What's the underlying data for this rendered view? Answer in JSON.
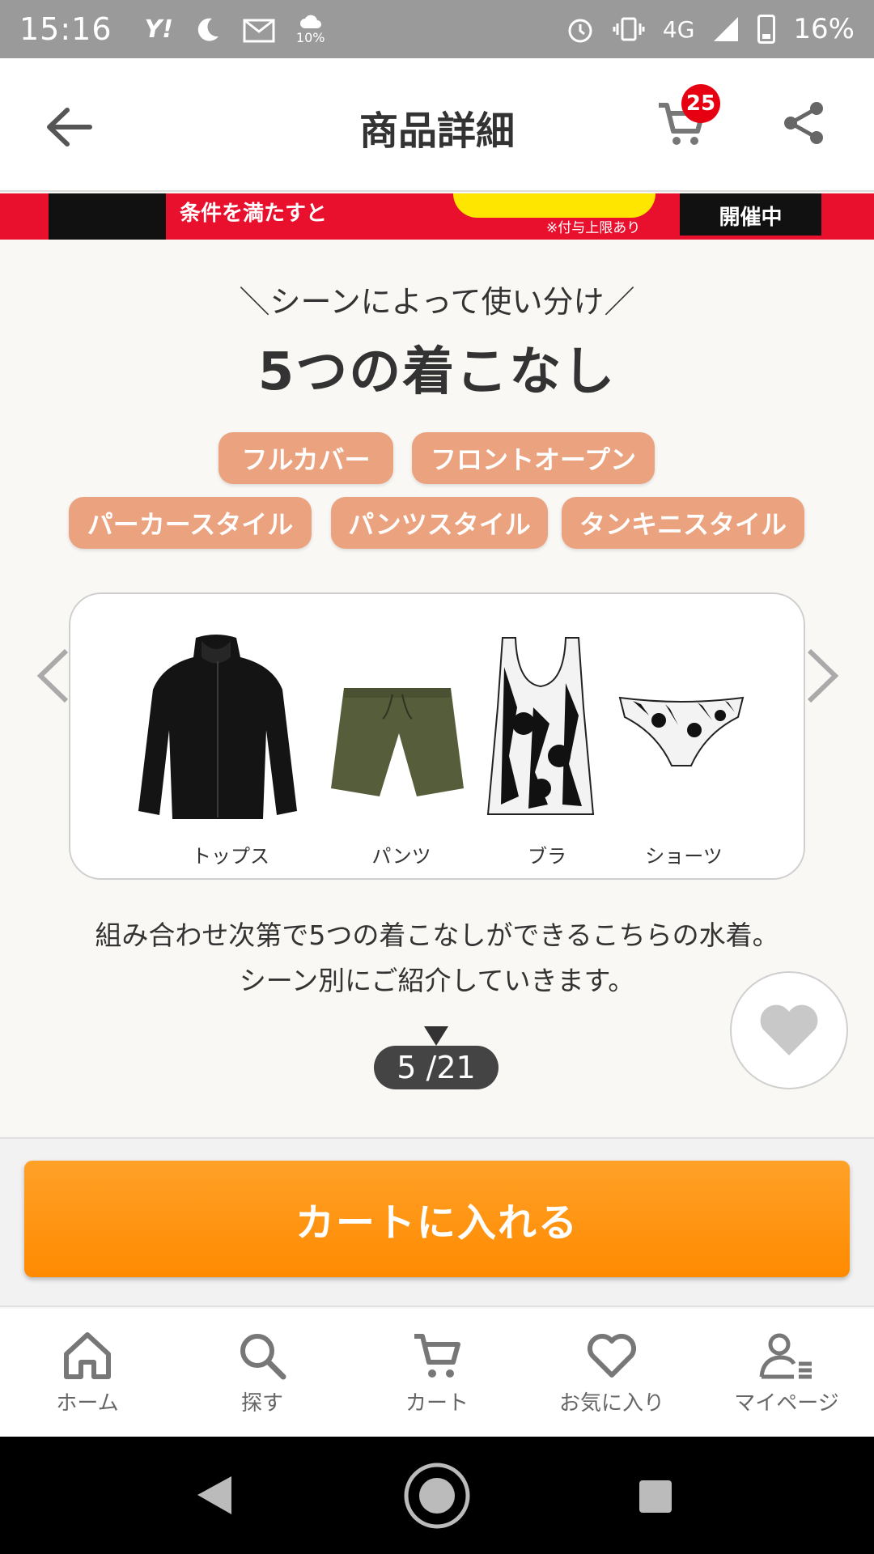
{
  "status_bar": {
    "time": "15:16",
    "weather_pct": "10%",
    "network": "4G",
    "battery": "16%"
  },
  "header": {
    "title": "商品詳細",
    "cart_badge": "25"
  },
  "promo": {
    "text": "条件を満たすと",
    "note": "※付与上限あり",
    "cta": "開催中"
  },
  "feature": {
    "subtitle": "＼シーンによって使い分け／",
    "title": "5つの着こなし",
    "styles": [
      "フルカバー",
      "フロントオープン",
      "パーカースタイル",
      "パンツスタイル",
      "タンキニスタイル"
    ]
  },
  "items": [
    {
      "label": "トップス",
      "icon": "jacket-image"
    },
    {
      "label": "パンツ",
      "icon": "shorts-image"
    },
    {
      "label": "ブラ",
      "icon": "tankini-top-image"
    },
    {
      "label": "ショーツ",
      "icon": "bikini-bottom-image"
    }
  ],
  "description": {
    "line1": "組み合わせ次第で5つの着こなしができるこちらの水着。",
    "line2": "シーン別にご紹介していきます。"
  },
  "pager": {
    "current": "5",
    "total": "21"
  },
  "cart_button": {
    "label": "カートに入れる"
  },
  "tabs": [
    {
      "label": "ホーム",
      "icon": "home-icon"
    },
    {
      "label": "探す",
      "icon": "search-icon"
    },
    {
      "label": "カート",
      "icon": "cart-icon"
    },
    {
      "label": "お気に入り",
      "icon": "heart-icon"
    },
    {
      "label": "マイページ",
      "icon": "user-icon"
    }
  ],
  "colors": {
    "accent_orange": "#ff8a00",
    "pill": "#eba27f",
    "badge_red": "#e60012",
    "promo_red": "#e8102d"
  }
}
